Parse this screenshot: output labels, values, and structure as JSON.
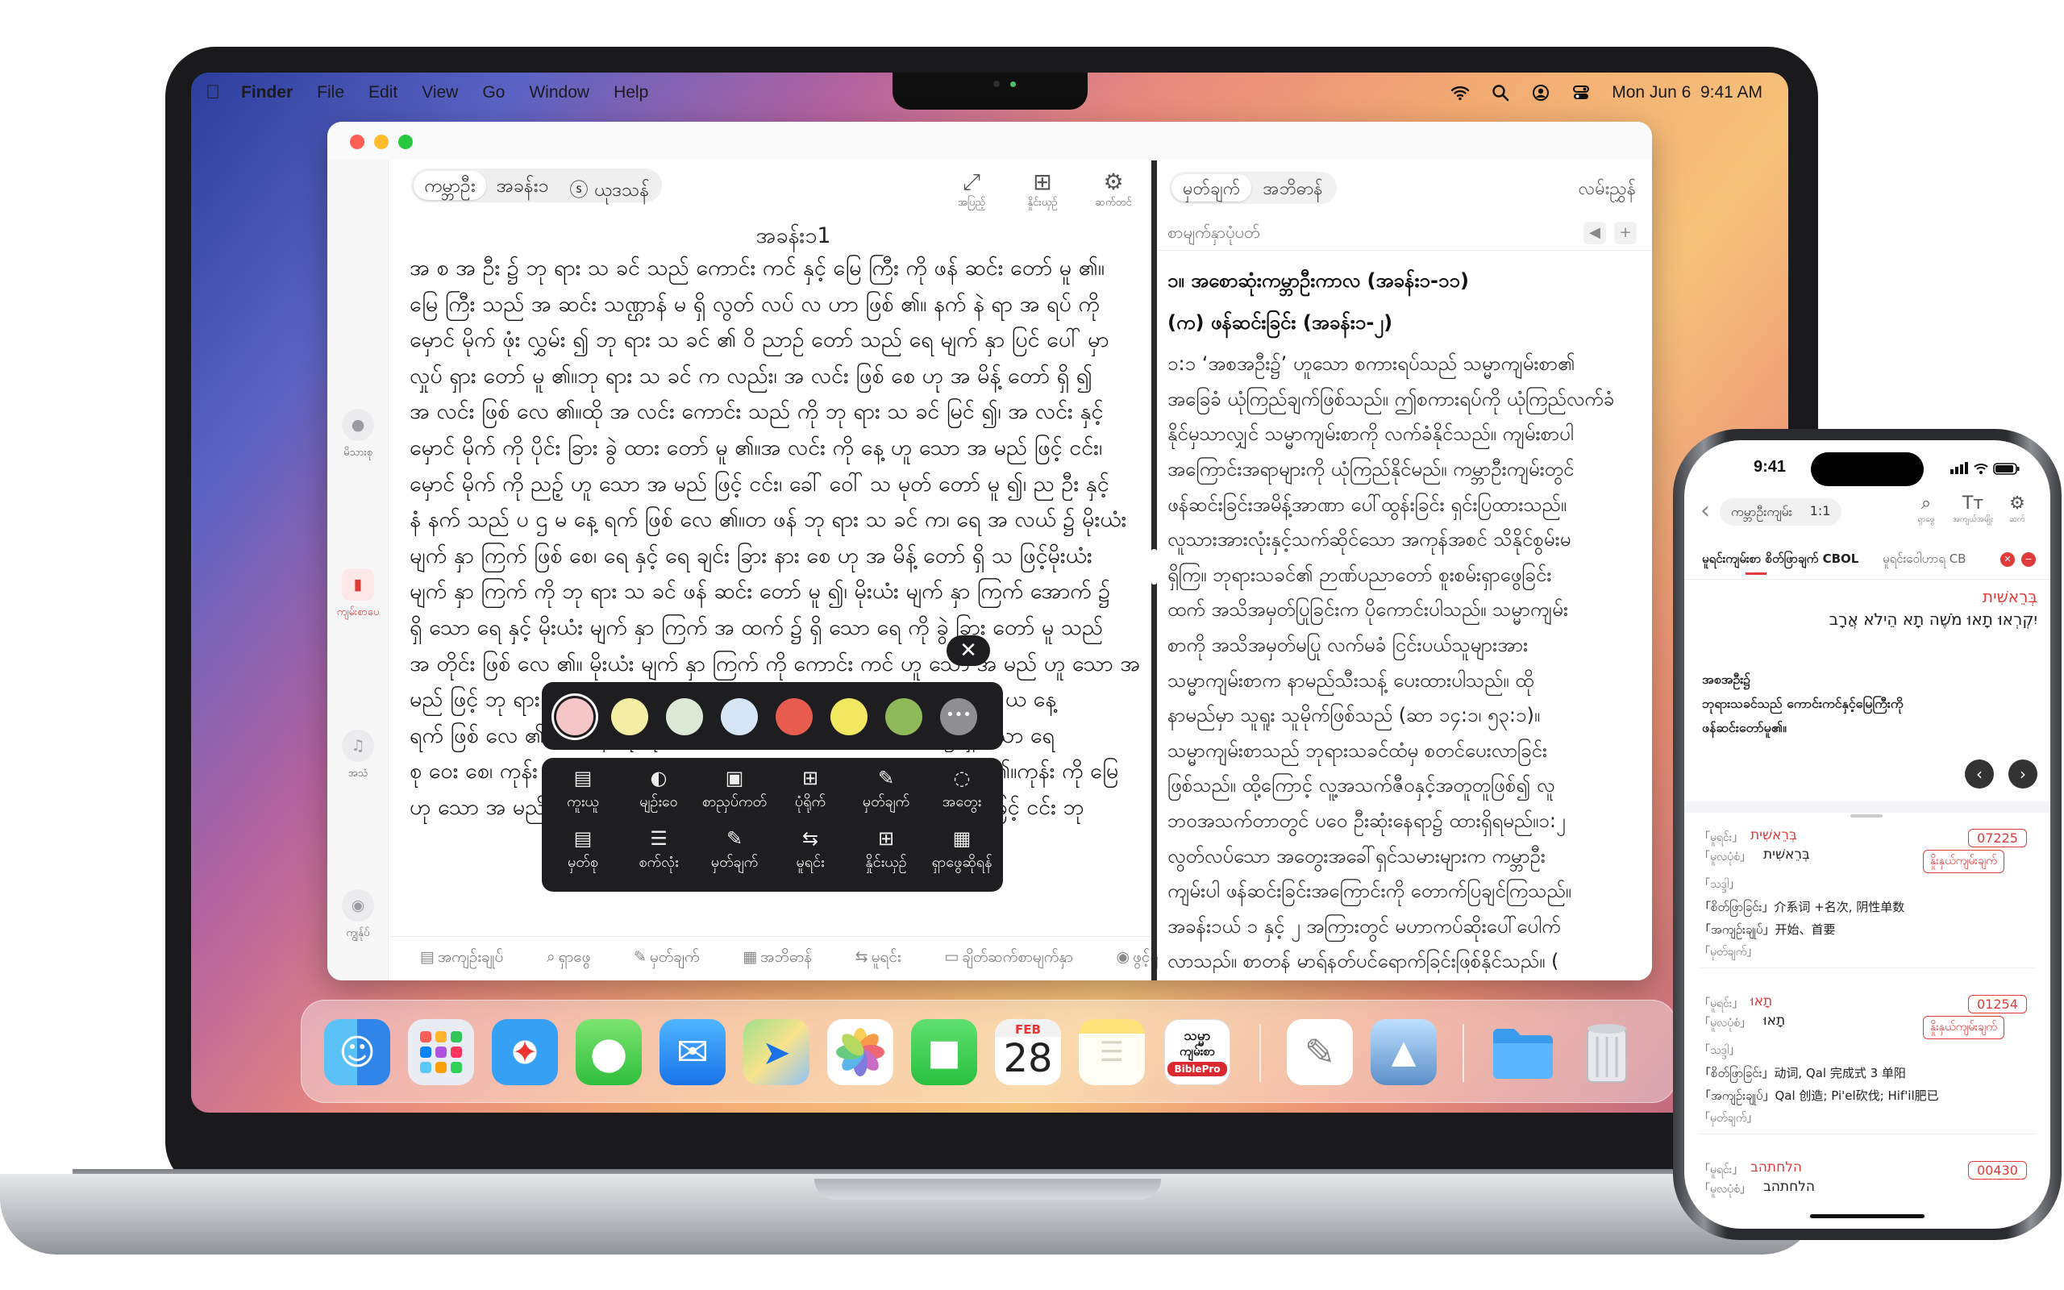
{
  "menubar": {
    "app": "Finder",
    "items": [
      "File",
      "Edit",
      "View",
      "Go",
      "Window",
      "Help"
    ],
    "datetime": "Mon Jun 6  9:41 AM"
  },
  "sidebar": {
    "items": [
      {
        "label": "မိသားစု"
      },
      {
        "label": "ကျမ်းစာပေ"
      },
      {
        "label": "အသံ"
      },
      {
        "label": "ကျွန်ုပ်"
      }
    ]
  },
  "reader": {
    "segment": [
      "ကမ္ဘာဦး",
      "အခန်း၁",
      "ⓢ ယုဒသန်"
    ],
    "tools": [
      {
        "label": "အပြည့်"
      },
      {
        "label": "နှိုင်းယှဉ်"
      },
      {
        "label": "ဆက်တင်"
      }
    ],
    "chapter_title": "အခန်း၁1",
    "lines": [
      "အ စ အ ဦး ၌ ဘု ရား သ ခင် သည် ကောင်း ကင် နှင့် မြေ ကြီး ကို ဖန် ဆင်း တော် မူ ၏။",
      "မြေ ကြီး သည် အ ဆင်း သဏ္ဌာန် မ ရှိ လွတ် လပ် လ ဟာ ဖြစ် ၏။ နက် နဲ ရာ အ ရပ် ကို",
      "မှောင် မိုက် ဖုံး လွှမ်း ၍ ဘု ရား သ ခင် ၏ ဝိ ညာဉ် တော် သည် ရေ မျက် နှာ ပြင် ပေါ် မှာ",
      "လှုပ် ရှား တော် မူ ၏။ဘု ရား သ ခင် က လည်း၊ အ လင်း ဖြစ် စေ ဟု အ မိန့် တော် ရှိ ၍",
      "အ လင်း ဖြစ် လေ ၏။ထို အ လင်း ကောင်း သည် ကို ဘု ရား သ ခင် မြင် ၍၊ အ လင်း နှင့်",
      "မှောင် မိုက် ကို ပိုင်း ခြား ခွဲ ထား တော် မူ ၏။အ လင်း ကို နေ့ ဟူ သော အ မည် ဖြင့် ငင်း၊",
      "မှောင် မိုက် ကို ညဉ့် ဟူ သော အ မည် ဖြင့် ငင်း၊ ခေါ် ဝေါ် သ မုတ် တော် မူ ၍၊ ည ဦး နှင့်",
      "နံ နက် သည် ပ ဌ မ နေ့ ရက် ဖြစ် လေ ၏။တ ဖန် ဘု ရား သ ခင် က၊ ရေ အ လယ် ၌ မိုးယံး",
      "မျက် နှာ ကြက် ဖြစ် စေ၊ ရေ နှင့် ရေ ချင်း ခြား နား စေ ဟု အ မိန့် တော် ရှိ သ ဖြင့်မိုးယံး",
      "မျက် နှာ ကြက် ကို ဘု ရား သ ခင် ဖန် ဆင်း တော် မူ ၍၊ မိုးယံး မျက် နှာ ကြက် အောက် ၌",
      "ရှိ သော ရေ နှင့် မိုးယံး မျက် နှာ ကြက် အ ထက် ၌ ရှိ သော ရေ ကို ခွဲ ခြား တော် မူ သည်",
      "အ တိုင်း ဖြစ် လေ ၏။ မိုးယံး မျက် နှာ ကြက် ကို ကောင်း ကင် ဟူ သော အ မည် ဟူ သော အ",
      "မည် ဖြင့် ဘု ရား သ ခင် သ မုတ် တော် မူ ၍၊ ည ဦး နှင့် နံ နက် သည် ဒု တိ ယ နေ့",
      "ရက် ဖြစ် လေ ၏။ တ ဖန် ဘု ရား သ ခင် က၊ ကောင်း ကင် အောက် ၌ ရှိ သော ရေ",
      "စု ဝေး စေ၊ ကုန်း ကို ထင် ရှား စေ ဟု အ မိန့် တော် ရှိ ၍ ထို အ တိုင်း ဖြစ် ၏။ကုန်း ကို မြေ",
      "ဟု သော အ မည် ဖြင့် ငင်း ရေ စု ဝေး ရာ ကို ပင် လယ် ဟု သော အ မည် ဖြင့် ငင်း ဘု"
    ],
    "bottom": [
      {
        "icon": "▤",
        "label": "အကျဉ်းချုပ်"
      },
      {
        "icon": "⌕",
        "label": "ရှာဖွေ"
      },
      {
        "icon": "✎",
        "label": "မှတ်ချက်"
      },
      {
        "icon": "▦",
        "label": "အဘိဓာန်"
      },
      {
        "icon": "⇆",
        "label": "မူရင်း"
      },
      {
        "icon": "▭",
        "label": "ချိတ်ဆက်စာမျက်နှာ"
      },
      {
        "icon": "◉",
        "label": "ဖွင့်ရန်"
      }
    ]
  },
  "popup": {
    "close": "✕",
    "colors": [
      "#f7c7c7",
      "#f4eea4",
      "#dbe9d6",
      "#d6e6f7",
      "#e85b4f",
      "#f3e862",
      "#8fba5a",
      "#8e8e93"
    ],
    "more": "•••",
    "actions": [
      {
        "icon": "▤",
        "label": "ကူးယူ"
      },
      {
        "icon": "◐",
        "label": "မျဉ်းဝေ"
      },
      {
        "icon": "▣",
        "label": "စာညှပ်ကတ်"
      },
      {
        "icon": "⊞",
        "label": "ပုံရိုက်"
      },
      {
        "icon": "✎",
        "label": "မှတ်ချက်"
      },
      {
        "icon": "◌",
        "label": "အတွေး"
      },
      {
        "icon": "▤",
        "label": "မှတ်စု"
      },
      {
        "icon": "☰",
        "label": "စက်လုံး"
      },
      {
        "icon": "✎",
        "label": "မှတ်ချက်"
      },
      {
        "icon": "⇆",
        "label": "မူရင်း"
      },
      {
        "icon": "⊞",
        "label": "နှိုင်းယှဉ်"
      },
      {
        "icon": "▦",
        "label": "ရှာဖွေဆိုရန်"
      }
    ]
  },
  "commentary": {
    "segment": [
      "မှတ်ချက်",
      "အဘိဓာန်"
    ],
    "right_label": "လမ်းညွှန်",
    "sub_title": "စာမျက်နှာပုံပတ်",
    "headings": [
      "၁။ အစောဆုံးကမ္ဘာဦးကာလ (အခန်း၁-၁၁)",
      "(က) ဖန်ဆင်းခြင်း (အခန်း၁-၂)"
    ],
    "lines": [
      "၁:၁ ‘အစအဦး၌’ ဟူသော စကားရပ်သည် သမ္မာကျမ်းစာ၏",
      "အခြေခံ ယုံကြည်ချက်ဖြစ်သည်။ ဤစကားရပ်ကို ယုံကြည်လက်ခံ",
      "နိုင်မှသာလျှင် သမ္မာကျမ်းစာကို လက်ခံနိုင်သည်။ ကျမ်းစာပါ",
      "အကြောင်းအရာများကို ယုံကြည်နိုင်မည်။ ကမ္ဘာဦးကျမ်းတွင်",
      "ဖန်ဆင်းခြင်းအမိန့်အာဏာ ပေါ်ထွန်းခြင်း ရှင်းပြထားသည်။",
      "လူသားအားလုံးနှင့်သက်ဆိုင်သော အကုန်အစင် သိနိုင်စွမ်းမ",
      "ရှိကြ။ ဘုရားသခင်၏ ဉာဏ်ပညာတော် စူးစမ်းရှာဖွေခြင်း",
      "ထက် အသိအမှတ်ပြုခြင်းက ပိုကောင်းပါသည်။ သမ္မာကျမ်း",
      "စာကို အသိအမှတ်မပြု လက်မခံ ငြင်းပယ်သူများအား",
      "သမ္မာကျမ်းစာက နာမည်သီးသန့် ပေးထားပါသည်။ ထို",
      "နာမည်မှာ သူရူး သူမိုက်ဖြစ်သည် (ဆာ ၁၄:၁၊ ၅၃:၁)။",
      "သမ္မာကျမ်းစာသည် ဘုရားသခင်ထံမှ စတင်ပေးလာခြင်း",
      "ဖြစ်သည်။ ထို့ကြောင့် လူ့အသက်ဇီဝနှင့်အတူတူဖြစ်၍ လူ",
      "ဘဝအသက်တာတွင် ပဝေ ဦးဆုံးနေရာ၌ ထားရှိရမည်။၁:၂",
      "လွတ်လပ်သော အတွေးအခေါ်ရှင်သမားများက ကမ္ဘာဦး",
      "ကျမ်းပါ ဖန်ဆင်းခြင်းအကြောင်းကို တောက်ပြချင်ကြသည်။",
      "အခန်း၁ယ် ၁ နှင့် ၂ အကြားတွင် မဟာကပ်ဆိုးပေါ်ပေါက်",
      "လာသည်။ စာတန် မာရ်နတ်ပင်ရောက်ခြင်းဖြစ်နိုင်သည်။ ("
    ]
  },
  "dock": {
    "calendar": {
      "month": "FEB",
      "day": "28"
    },
    "bible_app": {
      "line1": "သမ္မာ",
      "line2": "ကျမ်းစာ",
      "line3": "BiblePro"
    }
  },
  "phone": {
    "time": "9:41",
    "book": "ကမ္ဘာဦးကျမ်း",
    "chapter": "1:1",
    "tools": [
      {
        "label": "ရှာဖွေ"
      },
      {
        "label": "အကျယ်အမျိုး"
      },
      {
        "label": "ဆက်"
      }
    ],
    "tabs": [
      "မူရင်းကျမ်းစာ စိတ်ဖြာချက် CBOL",
      "မူရင်းဝေါဟာရ CB"
    ],
    "hebrew_word": "בְּרֵאשִׁית",
    "hebrew_line": "יִקְרְאוּ תָאוּ מֹשֶׁה תָא הֵילֹא אֲרָב",
    "burmese": [
      "အစအဦး၌",
      "ဘုရားသခင်သည် ကောင်းကင်နှင့်မြေကြီးကို",
      "ဖန်ဆင်းတော်မူ၏။"
    ],
    "entries": [
      {
        "r1_label": "「မူရင်း」",
        "r1_word": "בְּרֵאשִׁית",
        "code": "07225",
        "r2_label": "「မူလပုံစံ」",
        "r2_word": "בְּרֵאשִׁית",
        "button": "နှိုးနှယ်ကျမ်းချက်",
        "r3": "「သဒ္ဒါ」",
        "r4": "「စိတ်ဖြာခြင်း」介系词 +名次, 阴性单数",
        "r5": "「အကျဉ်းချုပ်」开始、首要",
        "r6": "「မှတ်ချက်」"
      },
      {
        "r1_label": "「မူရင်း」",
        "r1_word": "תָאוּ",
        "code": "01254",
        "r2_label": "「မူလပုံစံ」",
        "r2_word": "תָאוּ",
        "button": "နှိုးနှယ်ကျမ်းချက်",
        "r3": "「သဒ္ဒါ」",
        "r4": "「စိတ်ဖြာခြင်း」动词, Qal 完成式 3 单阳",
        "r5": "「အကျဉ်းချုပ်」Qal 创造; Pi'el砍伐; Hif'il肥已",
        "r6": "「မှတ်ချက်」"
      },
      {
        "r1_label": "「မူရင်း」",
        "r1_word": "הלחתהב",
        "code": "00430",
        "r2_label": "「မူလပုံစံ」",
        "r2_word": "הלחתהב"
      }
    ]
  }
}
